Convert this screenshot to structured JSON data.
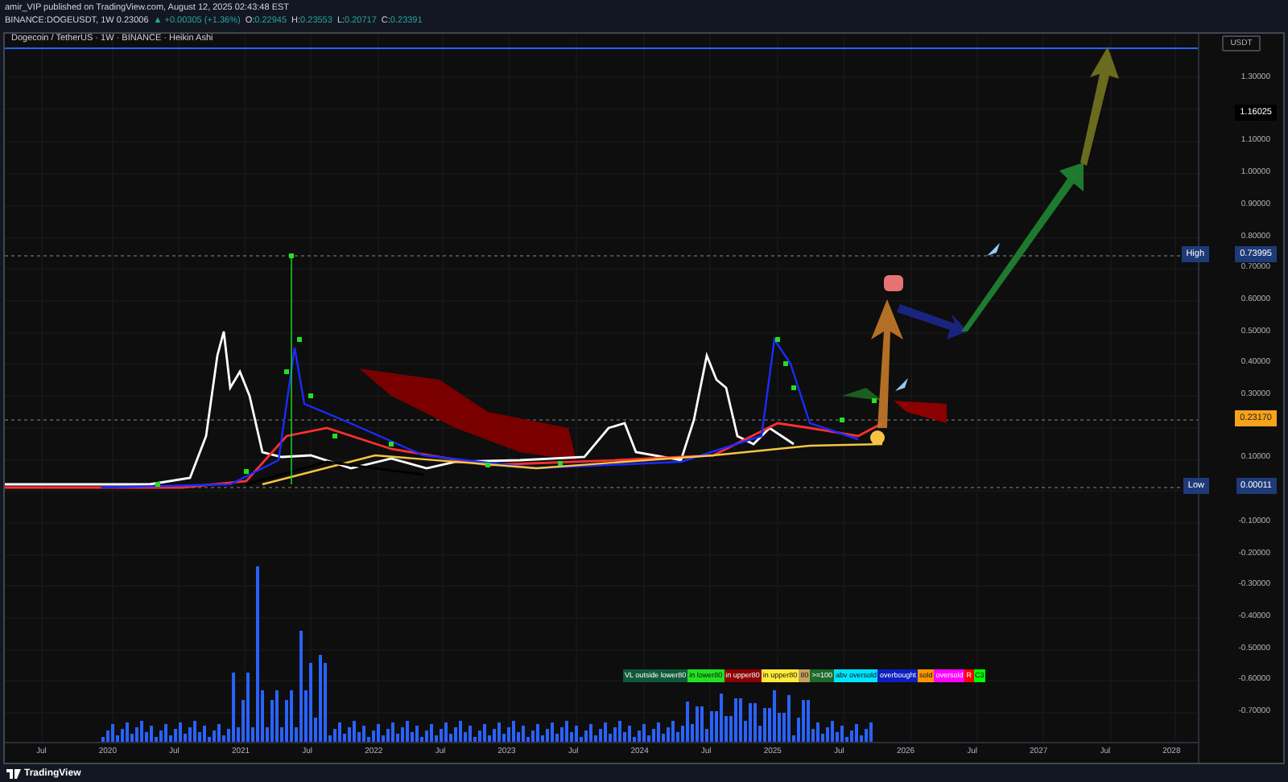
{
  "header": {
    "published": "amir_VIP published on TradingView.com, August 12, 2025 02:43:48 EST",
    "symbol": "BINANCE:DOGEUSDT, 1W 0.23006",
    "change": "▲ +0.00305 (+1.36%)",
    "ohlc": [
      {
        "label": "O:",
        "value": "0.22945"
      },
      {
        "label": "H:",
        "value": "0.23553"
      },
      {
        "label": "L:",
        "value": "0.20717"
      },
      {
        "label": "C:",
        "value": "0.23391"
      }
    ]
  },
  "chart": {
    "legend": "Dogecoin / TetherUS · 1W · BINANCE · Heikin Ashi",
    "currency": "USDT",
    "price_ticks": [
      "1.30000",
      "1.10000",
      "1.00000",
      "0.90000",
      "0.80000",
      "0.70000",
      "0.60000",
      "0.50000",
      "0.40000",
      "0.30000",
      "0.10000",
      "-0.10000",
      "-0.20000",
      "-0.30000",
      "-0.40000",
      "-0.50000",
      "-0.60000",
      "-0.70000"
    ],
    "price_markers": [
      {
        "kind": "last",
        "value": "1.16025"
      },
      {
        "kind": "high",
        "tag": "High",
        "value": "0.73995"
      },
      {
        "kind": "current",
        "value": "0.23170"
      },
      {
        "kind": "low",
        "tag": "Low",
        "value": "0.00011"
      }
    ],
    "time_ticks": [
      "Jul",
      "2020",
      "Jul",
      "2021",
      "Jul",
      "2022",
      "Jul",
      "2023",
      "Jul",
      "2024",
      "Jul",
      "2025",
      "Jul",
      "2026",
      "Jul",
      "2027",
      "Jul",
      "2028"
    ],
    "indicator_labels": [
      {
        "text": "VL outside lower80",
        "color": "#0f5a3a"
      },
      {
        "text": "in lower80",
        "color": "#22e022"
      },
      {
        "text": "in upper80",
        "color": "#8b0000"
      },
      {
        "text": "in upper80",
        "color": "#ffeb3b"
      },
      {
        "text": "80",
        "color": "#c8a060"
      },
      {
        "text": ">=100",
        "color": "#1b6b2a"
      },
      {
        "text": "abv oversold",
        "color": "#00e5ff"
      },
      {
        "text": "overbought",
        "color": "#0d1fc0"
      },
      {
        "text": "sold",
        "color": "#ff9800"
      },
      {
        "text": "oversold",
        "color": "#ff00ff"
      },
      {
        "text": "R",
        "color": "#ff0000"
      },
      {
        "text": "C3",
        "color": "#00ff00"
      }
    ]
  },
  "footer": {
    "brand": "TradingView"
  }
}
